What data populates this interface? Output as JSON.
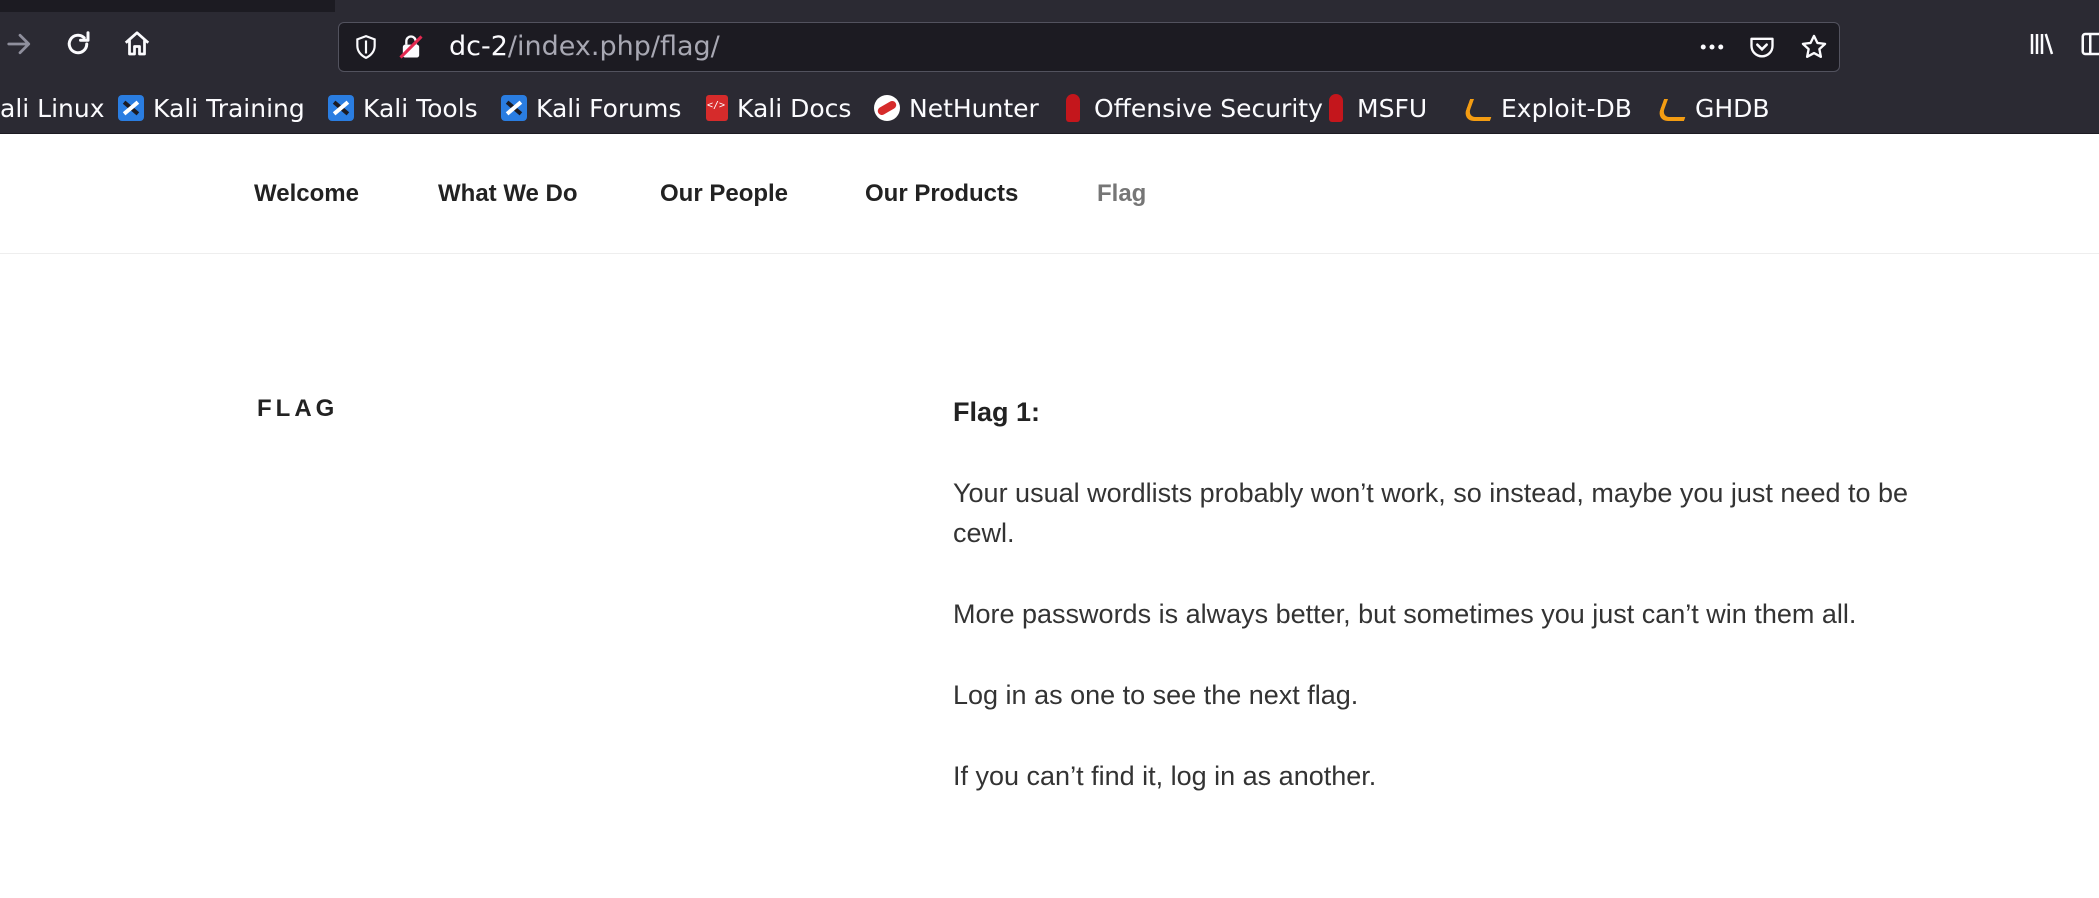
{
  "browser": {
    "url_host": "dc-2",
    "url_path": "/index.php/flag/",
    "url_overflow_icon": "ellipsis-icon",
    "bookmarks": [
      {
        "label": "ali Linux",
        "icon": "kali-icon"
      },
      {
        "label": "Kali Training",
        "icon": "kali-icon"
      },
      {
        "label": "Kali Tools",
        "icon": "kali-icon"
      },
      {
        "label": "Kali Forums",
        "icon": "kali-icon"
      },
      {
        "label": "Kali Docs",
        "icon": "kali-docs-icon"
      },
      {
        "label": "NetHunter",
        "icon": "nethunter-icon"
      },
      {
        "label": "Offensive Security",
        "icon": "offsec-icon"
      },
      {
        "label": "MSFU",
        "icon": "offsec-icon"
      },
      {
        "label": "Exploit-DB",
        "icon": "exploitdb-icon"
      },
      {
        "label": "GHDB",
        "icon": "exploitdb-icon"
      }
    ]
  },
  "site": {
    "nav": [
      {
        "label": "Welcome"
      },
      {
        "label": "What We Do"
      },
      {
        "label": "Our People"
      },
      {
        "label": "Our Products"
      },
      {
        "label": "Flag",
        "current": true
      }
    ],
    "page_title": "FLAG",
    "content": {
      "heading": "Flag 1:",
      "paragraphs": [
        "Your usual wordlists probably won’t work, so instead, maybe you just need to be cewl.",
        "More passwords is always better, but sometimes you just can’t win them all.",
        "Log in as one to see the next flag.",
        "If you can’t find it, log in as another."
      ]
    }
  },
  "colors": {
    "browser_chrome": "#2b2a33",
    "urlbar_bg": "#1c1b22",
    "nav_current": "#767676",
    "text": "#333333"
  }
}
